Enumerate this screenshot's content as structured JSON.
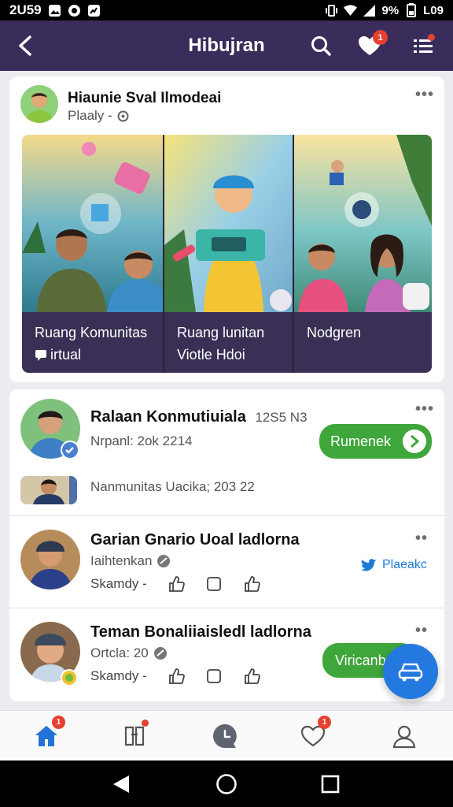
{
  "status_bar": {
    "time": "2U59",
    "battery": "9%",
    "battery_label": "L09"
  },
  "header": {
    "title": "Hibujran",
    "heart_badge": "1"
  },
  "post": {
    "author": "Hiaunie Sval Ilmodeai",
    "meta": "Plaaly -",
    "tiles": [
      {
        "line1": "Ruang Komunitas",
        "line2": "irtual"
      },
      {
        "line1": "Ruang lunitan",
        "line2": "Viotle Hdoi"
      },
      {
        "line1": "Nodgren",
        "line2": ""
      }
    ]
  },
  "community": {
    "item1": {
      "title": "Ralaan Konmutiuiala",
      "count": "12S5 N3",
      "sub": "Nrpanl: 2ok 2214",
      "button": "Rumenek"
    },
    "item1b": {
      "text": "Nanmunitas Uacika; 203 22"
    },
    "item2": {
      "title": "Garian Gnario Uoal ladlorna",
      "sub": "Iaihtenkan",
      "action1": "Skamdy -",
      "share_label": "Plaeakc"
    },
    "item3": {
      "title": "Teman Bonaliiaisledl ladlorna",
      "sub": "Ortcla: 20",
      "action1": "Skamdy -",
      "button": "Viricanb"
    }
  },
  "bottom_nav": {
    "home_badge": "1",
    "heart_badge": "1"
  },
  "colors": {
    "header_bg": "#3a2d5c",
    "accent_green": "#3fa63b",
    "fab_blue": "#2379df",
    "badge_red": "#e8402f"
  }
}
